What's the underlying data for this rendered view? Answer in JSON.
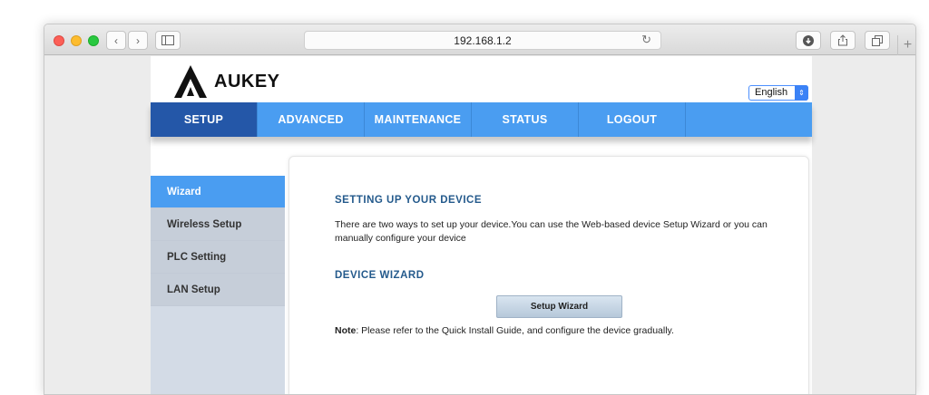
{
  "browser": {
    "url": "192.168.1.2"
  },
  "router": {
    "brand": "AUKEY",
    "language": "English",
    "nav": [
      "SETUP",
      "ADVANCED",
      "MAINTENANCE",
      "STATUS",
      "LOGOUT"
    ],
    "active_nav": "SETUP",
    "sidebar": [
      "Wizard",
      "Wireless Setup",
      "PLC Setting",
      "LAN Setup"
    ],
    "active_sidebar": "Wizard",
    "content": {
      "heading_setup": "SETTING UP YOUR DEVICE",
      "description": "There are two ways to set up your device.You can use the Web-based device Setup Wizard or you can manually configure your device",
      "heading_wizard": "DEVICE WIZARD",
      "wizard_button": "Setup Wizard",
      "note_label": "Note",
      "note_text": ": Please refer to the Quick Install Guide, and configure the device gradually."
    }
  },
  "colors": {
    "nav_blue": "#4a9df1",
    "nav_active": "#2457a8",
    "heading": "#245a8c"
  }
}
